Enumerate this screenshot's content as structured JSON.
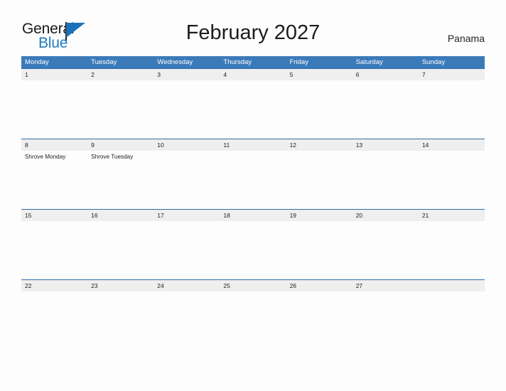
{
  "brand": {
    "word_one": "General",
    "word_two": "Blue",
    "flag_icon": "triangle-flag-icon",
    "accent_color": "#1b72b8"
  },
  "header": {
    "title": "February 2027",
    "country": "Panama"
  },
  "colors": {
    "header_blue": "#3b7ab9",
    "row_border_blue": "#2f6da8",
    "date_strip_gray": "#efefef",
    "page_background": "#fdfdfd",
    "text": "#1f1f1f"
  },
  "calendar": {
    "month": "February",
    "year": "2027",
    "week_start": "Monday",
    "day_headers": [
      "Monday",
      "Tuesday",
      "Wednesday",
      "Thursday",
      "Friday",
      "Saturday",
      "Sunday"
    ],
    "weeks": [
      {
        "days": [
          {
            "date": "1",
            "event": ""
          },
          {
            "date": "2",
            "event": ""
          },
          {
            "date": "3",
            "event": ""
          },
          {
            "date": "4",
            "event": ""
          },
          {
            "date": "5",
            "event": ""
          },
          {
            "date": "6",
            "event": ""
          },
          {
            "date": "7",
            "event": ""
          }
        ]
      },
      {
        "days": [
          {
            "date": "8",
            "event": "Shrove Monday"
          },
          {
            "date": "9",
            "event": "Shrove Tuesday"
          },
          {
            "date": "10",
            "event": ""
          },
          {
            "date": "11",
            "event": ""
          },
          {
            "date": "12",
            "event": ""
          },
          {
            "date": "13",
            "event": ""
          },
          {
            "date": "14",
            "event": ""
          }
        ]
      },
      {
        "days": [
          {
            "date": "15",
            "event": ""
          },
          {
            "date": "16",
            "event": ""
          },
          {
            "date": "17",
            "event": ""
          },
          {
            "date": "18",
            "event": ""
          },
          {
            "date": "19",
            "event": ""
          },
          {
            "date": "20",
            "event": ""
          },
          {
            "date": "21",
            "event": ""
          }
        ]
      },
      {
        "days": [
          {
            "date": "22",
            "event": ""
          },
          {
            "date": "23",
            "event": ""
          },
          {
            "date": "24",
            "event": ""
          },
          {
            "date": "25",
            "event": ""
          },
          {
            "date": "26",
            "event": ""
          },
          {
            "date": "27",
            "event": ""
          },
          {
            "date": "",
            "event": ""
          }
        ]
      }
    ]
  }
}
